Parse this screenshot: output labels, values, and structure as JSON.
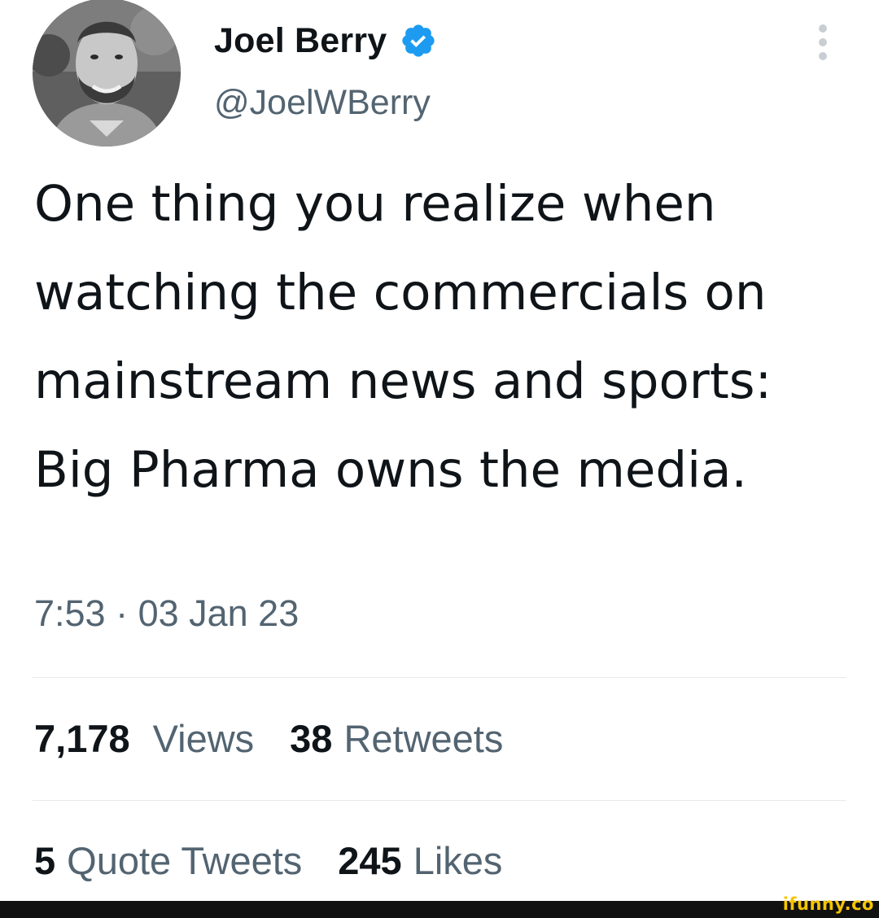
{
  "author": {
    "display_name": "Joel Berry",
    "handle": "@JoelWBerry",
    "verified_icon": "verified-badge-icon",
    "avatar_icon": "profile-photo"
  },
  "tweet": {
    "text": "One thing you realize when watching the commercials on mainstream news and sports: Big Pharma owns the media.",
    "timestamp": "7:53 · 03 Jan 23"
  },
  "stats": {
    "views_count": "7,178",
    "views_label": "Views",
    "retweets_count": "38",
    "retweets_label": "Retweets",
    "quotes_count": "5",
    "quotes_label": "Quote Tweets",
    "likes_count": "245",
    "likes_label": "Likes"
  },
  "watermark": {
    "text": "ifunny.co"
  },
  "colors": {
    "text_primary": "#0f1419",
    "text_secondary": "#536471",
    "verified": "#1d9bf0",
    "watermark": "#f4c400"
  }
}
